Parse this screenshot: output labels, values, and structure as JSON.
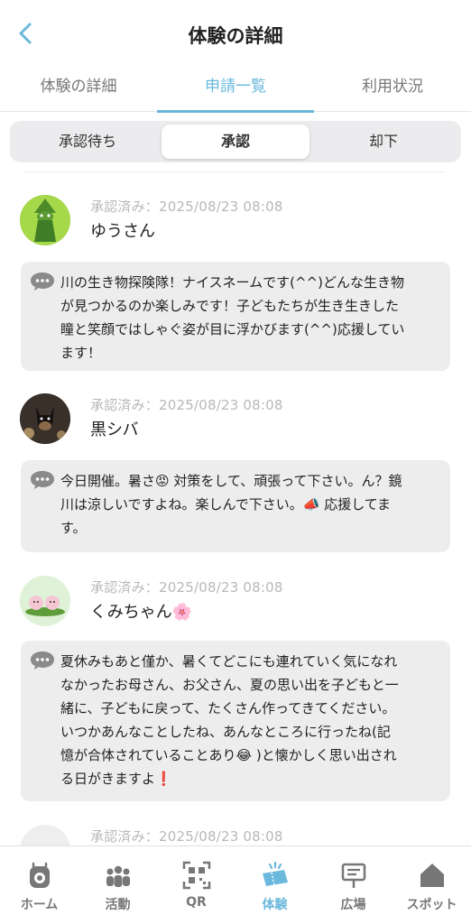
{
  "header": {
    "title": "体験の詳細"
  },
  "tabs": [
    {
      "label": "体験の詳細"
    },
    {
      "label": "申請一覧"
    },
    {
      "label": "利用状況"
    }
  ],
  "segments": [
    {
      "label": "承認待ち"
    },
    {
      "label": "承認"
    },
    {
      "label": "却下"
    }
  ],
  "entries": [
    {
      "status": "承認済み：2025/08/23 08:08",
      "name": "ゆうさん",
      "comment_lines": [
        "川の生き物探険隊！ナイスネームです(^^)どんな生き物",
        "が見つかるのか楽しみです！子どもたちが生き生きした",
        "瞳と笑顔ではしゃぐ姿が目に浮かびます(^^)応援してい",
        "ます！"
      ]
    },
    {
      "status": "承認済み：2025/08/23 08:08",
      "name": "黒シバ",
      "comment_lines": [
        "今日開催。暑さ😡 対策をして、頑張って下さい。ん？鏡",
        "川は涼しいですよね。楽しんで下さい。📣 応援してま",
        "す。"
      ]
    },
    {
      "status": "承認済み：2025/08/23 08:08",
      "name": "くみちゃん🌸",
      "comment_lines": [
        "夏休みもあと僅か、暑くてどこにも連れていく気になれ",
        "なかったお母さん、お父さん、夏の思い出を子どもと一",
        "緒に、子どもに戻って、たくさん作ってきてください。",
        "いつかあんなことしたね、あんなところに行ったね(記",
        "憶が合体されていることあり😂 )と懐かしく思い出され",
        "る日がきますよ❗"
      ]
    },
    {
      "status": "承認済み：2025/08/23 08:08"
    }
  ],
  "nav": [
    {
      "label": "ホーム",
      "icon": "home-icon"
    },
    {
      "label": "活動",
      "icon": "people-icon"
    },
    {
      "label": "QR",
      "icon": "qr-icon"
    },
    {
      "label": "体験",
      "icon": "ticket-icon"
    },
    {
      "label": "広場",
      "icon": "signboard-icon"
    },
    {
      "label": "スポット",
      "icon": "house-icon"
    }
  ],
  "colors": {
    "accent": "#6ab8dc",
    "bubble": "#ededee",
    "segment_bg": "#ececee"
  }
}
